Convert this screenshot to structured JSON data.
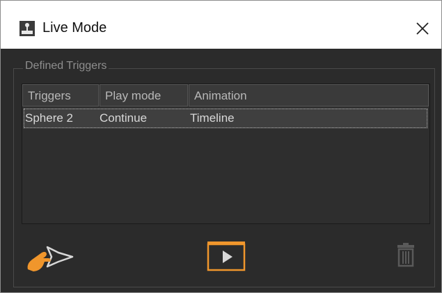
{
  "window": {
    "title": "Live Mode",
    "title_icon": "joystick-icon",
    "close_icon": "close-icon"
  },
  "triggers_group": {
    "label": "Defined Triggers",
    "columns": [
      "Triggers",
      "Play mode",
      "Animation"
    ],
    "rows": [
      {
        "trigger": "Sphere 2",
        "play_mode": "Continue",
        "animation": "Timeline",
        "selected": true
      }
    ]
  },
  "toolbar": {
    "add_trigger_icon": "hand-pointer-icon",
    "play_icon": "play-icon",
    "delete_icon": "trash-icon"
  },
  "colors": {
    "accent_orange": "#f0962c",
    "background": "#2b2b2b",
    "disabled_icon": "#5a5a5a"
  }
}
